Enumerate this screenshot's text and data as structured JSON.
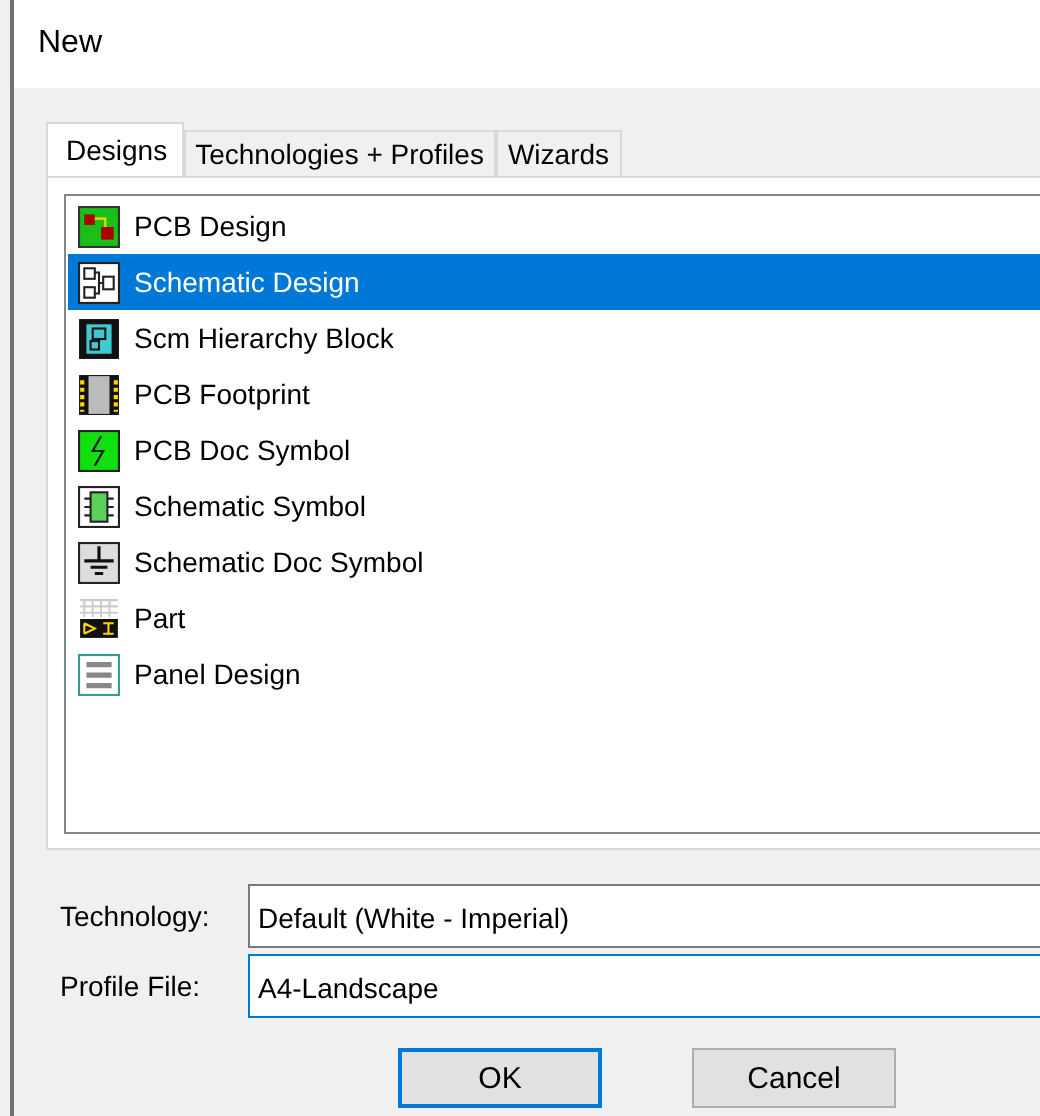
{
  "window": {
    "title": "New"
  },
  "tabs": [
    {
      "label": "Designs",
      "selected": true
    },
    {
      "label": "Technologies + Profiles",
      "selected": false
    },
    {
      "label": "Wizards",
      "selected": false
    }
  ],
  "items": [
    {
      "label": "PCB Design",
      "kind": "pcb",
      "selected": false
    },
    {
      "label": "Schematic Design",
      "kind": "schematic",
      "selected": true
    },
    {
      "label": "Scm Hierarchy Block",
      "kind": "block",
      "selected": false
    },
    {
      "label": "PCB Footprint",
      "kind": "footprint",
      "selected": false
    },
    {
      "label": "PCB Doc Symbol",
      "kind": "docsymbol",
      "selected": false
    },
    {
      "label": "Schematic Symbol",
      "kind": "symbol",
      "selected": false
    },
    {
      "label": "Schematic Doc Symbol",
      "kind": "ground",
      "selected": false
    },
    {
      "label": "Part",
      "kind": "part",
      "selected": false
    },
    {
      "label": "Panel Design",
      "kind": "panel",
      "selected": false
    }
  ],
  "fields": [
    {
      "label": "Technology:",
      "value": "Default (White - Imperial)",
      "focused": false
    },
    {
      "label": "Profile File:",
      "value": "A4-Landscape",
      "focused": true
    }
  ],
  "buttons": [
    {
      "label": "OK",
      "default": true
    },
    {
      "label": "Cancel",
      "default": false
    }
  ]
}
